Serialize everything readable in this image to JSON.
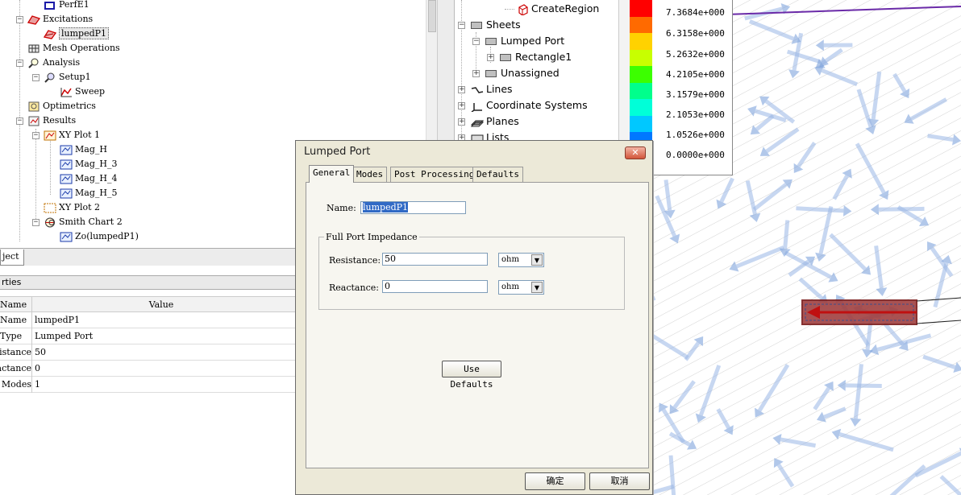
{
  "project_tree": {
    "items": [
      {
        "label": "PerfE1"
      },
      {
        "label": "Excitations"
      },
      {
        "label": "lumpedP1"
      },
      {
        "label": "Mesh Operations"
      },
      {
        "label": "Analysis"
      },
      {
        "label": "Setup1"
      },
      {
        "label": "Sweep"
      },
      {
        "label": "Optimetrics"
      },
      {
        "label": "Results"
      },
      {
        "label": "XY Plot 1"
      },
      {
        "label": "Mag_H"
      },
      {
        "label": "Mag_H_3"
      },
      {
        "label": "Mag_H_4"
      },
      {
        "label": "Mag_H_5"
      },
      {
        "label": "XY Plot 2"
      },
      {
        "label": "Smith Chart 2"
      },
      {
        "label": "Zo(lumpedP1)"
      }
    ]
  },
  "project_tab": {
    "label": "ject"
  },
  "properties": {
    "header": "rties",
    "col_name": "Name",
    "col_value": "Value",
    "rows": [
      {
        "name": "Name",
        "value": "lumpedP1"
      },
      {
        "name": "Type",
        "value": "Lumped Port"
      },
      {
        "name": "Resistance",
        "value": "50"
      },
      {
        "name": "Reactance",
        "value": "0"
      },
      {
        "name": "Num Modes",
        "value": "1"
      }
    ]
  },
  "model_tree": {
    "items": [
      {
        "label": "CreateRegion"
      },
      {
        "label": "Sheets"
      },
      {
        "label": "Lumped Port"
      },
      {
        "label": "Rectangle1"
      },
      {
        "label": "Unassigned"
      },
      {
        "label": "Lines"
      },
      {
        "label": "Coordinate Systems"
      },
      {
        "label": "Planes"
      },
      {
        "label": "Lists"
      }
    ]
  },
  "legend": {
    "values": [
      "7.3684e+000",
      "6.3158e+000",
      "5.2632e+000",
      "4.2105e+000",
      "3.1579e+000",
      "2.1053e+000",
      "1.0526e+000",
      "0.0000e+000"
    ],
    "colors": [
      "#ff0000",
      "#ff6a00",
      "#ffd200",
      "#c8ff00",
      "#3cff00",
      "#00ff8c",
      "#00ffd8",
      "#00c8ff",
      "#0078ff",
      "#0028ff"
    ]
  },
  "dialog": {
    "title": "Lumped Port",
    "close_label": "✕",
    "tabs": [
      "General",
      "Modes",
      "Post Processing",
      "Defaults"
    ],
    "name_label": "Name:",
    "name_value": "lumpedP1",
    "group_title": "Full Port Impedance",
    "resistance_label": "Resistance:",
    "resistance_value": "50",
    "resistance_unit": "ohm",
    "reactance_label": "Reactance:",
    "reactance_value": "0",
    "reactance_unit": "ohm",
    "use_defaults": "Use Defaults",
    "ok": "确定",
    "cancel": "取消"
  }
}
